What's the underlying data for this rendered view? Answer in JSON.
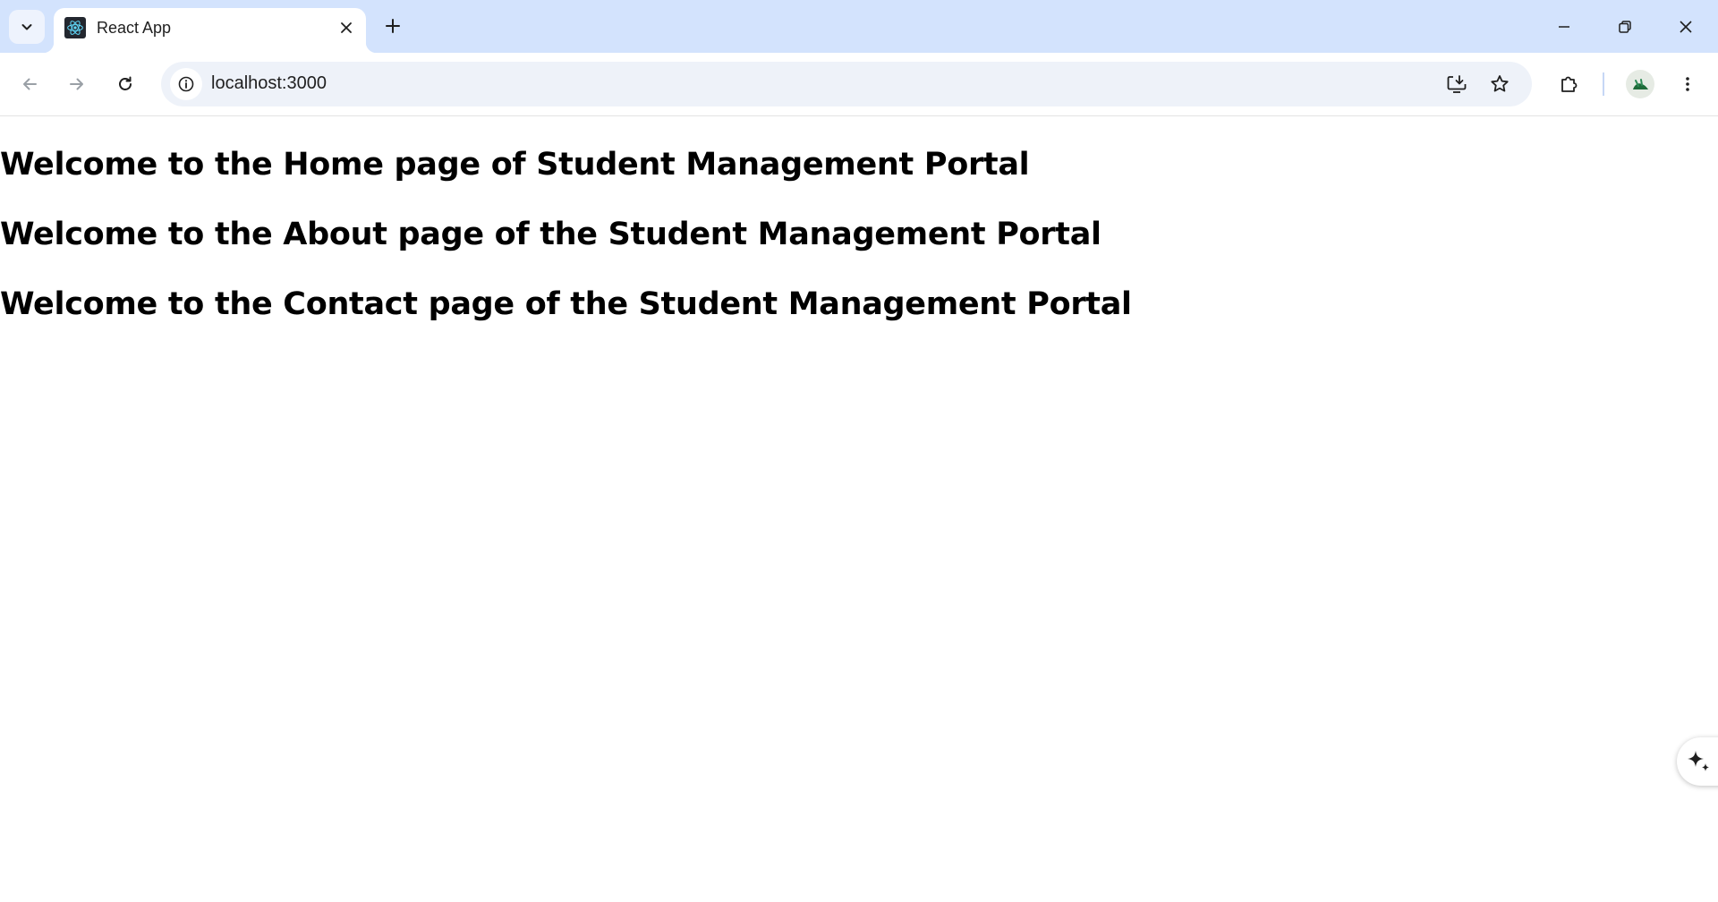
{
  "browser": {
    "tab": {
      "title": "React App",
      "favicon": "react-logo-icon"
    },
    "address": {
      "url": "localhost:3000"
    },
    "icons": {
      "tab_search": "chevron-down-icon",
      "close_tab": "close-icon",
      "new_tab": "plus-icon",
      "minimize": "minimize-icon",
      "restore": "restore-icon",
      "close_window": "close-icon",
      "back": "arrow-left-icon",
      "forward": "arrow-right-icon",
      "reload": "reload-icon",
      "site_info": "info-icon",
      "install": "install-app-icon",
      "bookmark": "star-icon",
      "extensions": "puzzle-icon",
      "profile": "avatar",
      "menu": "kebab-menu-icon"
    },
    "colors": {
      "tabstrip": "#d3e3fd",
      "omnibox": "#eef2f9",
      "text": "#1f1f1f"
    }
  },
  "page": {
    "headings": {
      "home": "Welcome to the Home page of Student Management Portal",
      "about": "Welcome to the About page of the Student Management Portal",
      "contact": "Welcome to the Contact page of the Student Management Portal"
    }
  },
  "floating": {
    "icon": "sparkle-icon"
  }
}
